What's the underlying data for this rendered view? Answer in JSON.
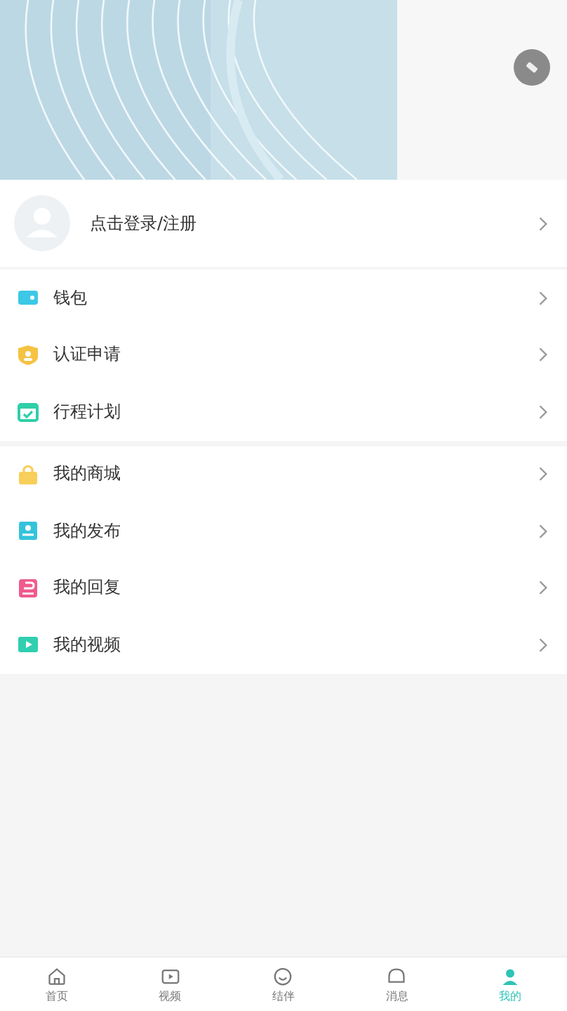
{
  "login": {
    "label": "点击登录/注册"
  },
  "groups": [
    {
      "items": [
        {
          "label": "钱包",
          "kind": "wallet",
          "color": "#3cc8e6"
        },
        {
          "label": "认证申请",
          "kind": "shield",
          "color": "#f5c242"
        },
        {
          "label": "行程计划",
          "kind": "calendar",
          "color": "#2fcfa8"
        }
      ]
    },
    {
      "items": [
        {
          "label": "我的商城",
          "kind": "bag",
          "color": "#f7cf5a"
        },
        {
          "label": "我的发布",
          "kind": "publish",
          "color": "#35c3dc"
        },
        {
          "label": "我的回复",
          "kind": "reply",
          "color": "#ef5b8c"
        },
        {
          "label": "我的视频",
          "kind": "video",
          "color": "#2fcfb0"
        }
      ]
    }
  ],
  "tabbar": [
    {
      "label": "首页",
      "kind": "home",
      "selected": false
    },
    {
      "label": "视频",
      "kind": "video",
      "selected": false
    },
    {
      "label": "结伴",
      "kind": "smile",
      "selected": false
    },
    {
      "label": "消息",
      "kind": "message",
      "selected": false
    },
    {
      "label": "我的",
      "kind": "me",
      "selected": true
    }
  ]
}
